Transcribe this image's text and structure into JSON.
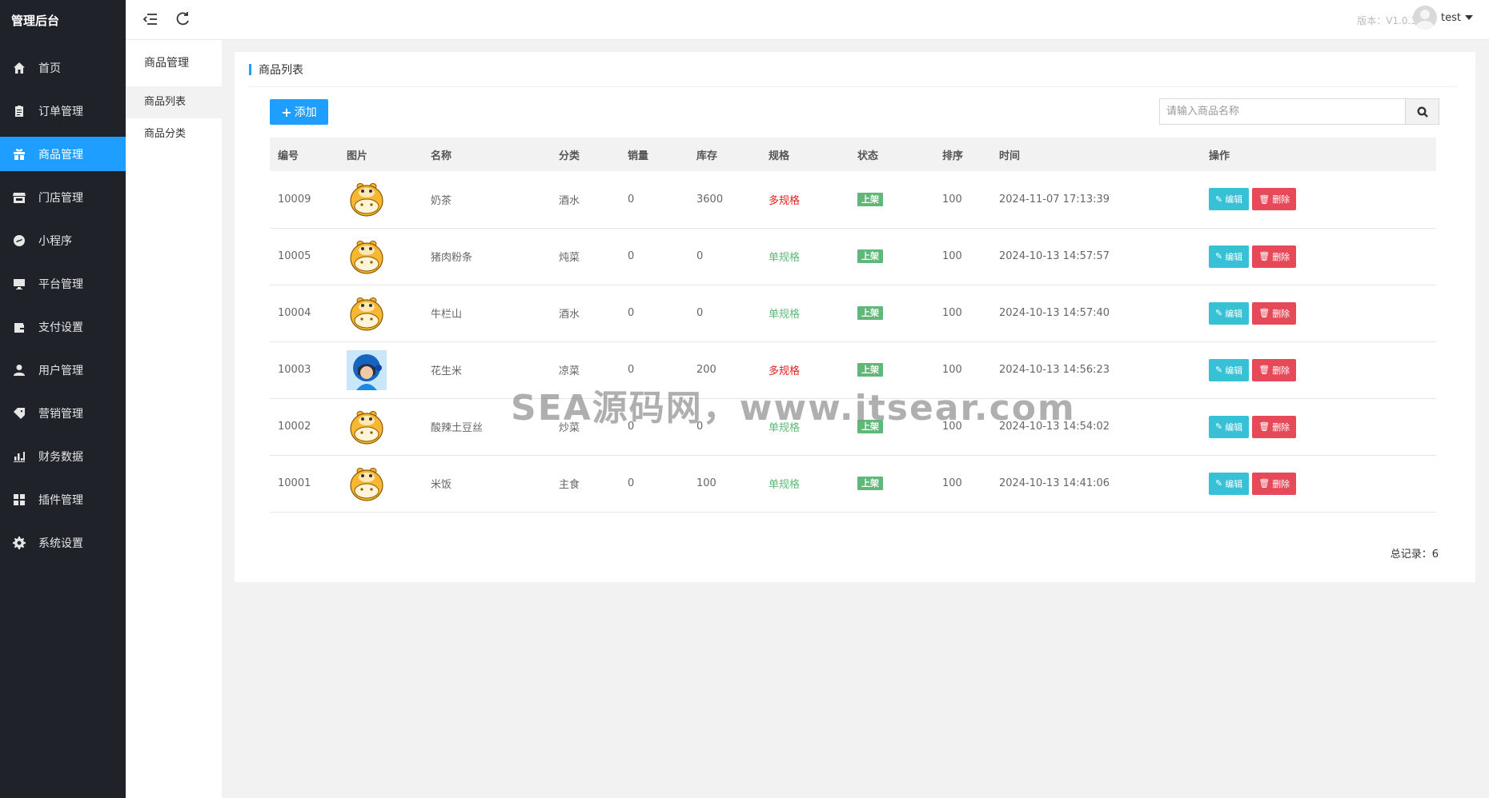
{
  "app": {
    "title": "管理后台"
  },
  "sidebar": {
    "items": [
      {
        "label": "首页",
        "icon": "home-icon"
      },
      {
        "label": "订单管理",
        "icon": "clipboard-icon"
      },
      {
        "label": "商品管理",
        "icon": "gift-icon",
        "active": true
      },
      {
        "label": "门店管理",
        "icon": "store-icon"
      },
      {
        "label": "小程序",
        "icon": "miniprogram-icon"
      },
      {
        "label": "平台管理",
        "icon": "monitor-icon"
      },
      {
        "label": "支付设置",
        "icon": "wallet-icon"
      },
      {
        "label": "用户管理",
        "icon": "user-icon"
      },
      {
        "label": "营销管理",
        "icon": "tag-icon"
      },
      {
        "label": "财务数据",
        "icon": "bar-chart-icon"
      },
      {
        "label": "插件管理",
        "icon": "puzzle-icon"
      },
      {
        "label": "系统设置",
        "icon": "gear-icon"
      }
    ]
  },
  "topbar": {
    "version": "版本：V1.0.3",
    "user": "test"
  },
  "submenu": {
    "title": "商品管理",
    "items": [
      "商品列表",
      "商品分类"
    ]
  },
  "card": {
    "title": "商品列表",
    "add_label": "添加",
    "search_placeholder": "请输入商品名称"
  },
  "table": {
    "headers": [
      "编号",
      "图片",
      "名称",
      "分类",
      "销量",
      "库存",
      "规格",
      "状态",
      "排序",
      "时间",
      "操作"
    ],
    "rows": [
      {
        "id": "10009",
        "image": "hippo",
        "name": "奶茶",
        "category": "酒水",
        "sales": "0",
        "stock": "3600",
        "spec": "多规格",
        "spec_type": "multi",
        "status": "上架",
        "sort": "100",
        "time": "2024-11-07 17:13:39"
      },
      {
        "id": "10005",
        "image": "hippo",
        "name": "猪肉粉条",
        "category": "炖菜",
        "sales": "0",
        "stock": "0",
        "spec": "单规格",
        "spec_type": "single",
        "status": "上架",
        "sort": "100",
        "time": "2024-10-13 14:57:57"
      },
      {
        "id": "10004",
        "image": "hippo",
        "name": "牛栏山",
        "category": "酒水",
        "sales": "0",
        "stock": "0",
        "spec": "单规格",
        "spec_type": "single",
        "status": "上架",
        "sort": "100",
        "time": "2024-10-13 14:57:40"
      },
      {
        "id": "10003",
        "image": "helmet",
        "name": "花生米",
        "category": "凉菜",
        "sales": "0",
        "stock": "200",
        "spec": "多规格",
        "spec_type": "multi",
        "status": "上架",
        "sort": "100",
        "time": "2024-10-13 14:56:23"
      },
      {
        "id": "10002",
        "image": "hippo",
        "name": "酸辣土豆丝",
        "category": "炒菜",
        "sales": "0",
        "stock": "0",
        "spec": "单规格",
        "spec_type": "single",
        "status": "上架",
        "sort": "100",
        "time": "2024-10-13 14:54:02"
      },
      {
        "id": "10001",
        "image": "hippo",
        "name": "米饭",
        "category": "主食",
        "sales": "0",
        "stock": "100",
        "spec": "单规格",
        "spec_type": "single",
        "status": "上架",
        "sort": "100",
        "time": "2024-10-13 14:41:06"
      }
    ],
    "edit_label": "编辑",
    "delete_label": "删除"
  },
  "footer": {
    "total": "总记录：6"
  },
  "watermark": "SEA源码网，www.itsear.com",
  "colors": {
    "accent": "#1e9fff",
    "sidebar_bg": "#20222a",
    "success": "#5fb878",
    "danger": "#e64a59",
    "info": "#36c1d6",
    "multi_spec": "#e02020"
  }
}
